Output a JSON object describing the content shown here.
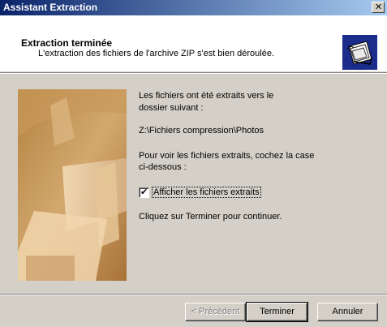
{
  "window": {
    "title": "Assistant Extraction",
    "close_glyph": "✕"
  },
  "header": {
    "title": "Extraction terminée",
    "subtitle": "L'extraction des fichiers de l'archive ZIP s'est bien déroulée.",
    "icon": "folder-files-icon"
  },
  "content": {
    "line1": "Les fichiers ont été extraits vers le",
    "line2": "dossier suivant :",
    "path": "Z:\\Fichiers compression\\Photos",
    "instruction1": "Pour voir les fichiers extraits, cochez la case",
    "instruction2": "ci-dessous :",
    "checkbox_label": "Afficher les fichiers extraits",
    "checkbox_checked": true,
    "checkbox_mark": "✔",
    "finish_hint": "Cliquez sur Terminer pour continuer."
  },
  "buttons": {
    "back": "< Précédent",
    "finish": "Terminer",
    "cancel": "Annuler"
  },
  "colors": {
    "titlebar_start": "#0a246a",
    "titlebar_end": "#a6caf0",
    "dialog_face": "#d4d0c8",
    "icon_bg": "#1a2c8c"
  }
}
